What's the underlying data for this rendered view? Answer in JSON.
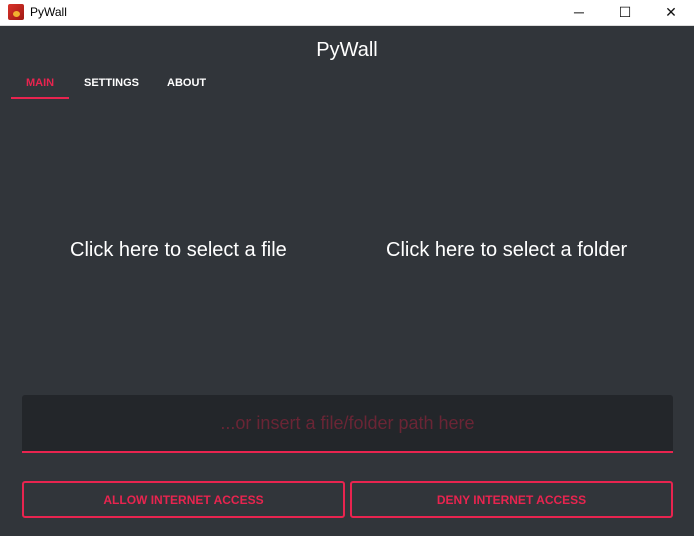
{
  "window": {
    "title": "PyWall",
    "minimize": "─",
    "maximize": "☐",
    "close": "✕"
  },
  "app": {
    "title": "PyWall"
  },
  "tabs": [
    {
      "label": "MAIN",
      "active": true
    },
    {
      "label": "SETTINGS",
      "active": false
    },
    {
      "label": "ABOUT",
      "active": false
    }
  ],
  "main": {
    "select_file": "Click here to select a file",
    "select_folder": "Click here to select a folder",
    "path_input": {
      "value": "",
      "placeholder": "...or insert a file/folder path here"
    },
    "allow_button": "ALLOW INTERNET ACCESS",
    "deny_button": "DENY INTERNET ACCESS"
  },
  "colors": {
    "accent": "#e8244f",
    "background": "#31353a"
  }
}
